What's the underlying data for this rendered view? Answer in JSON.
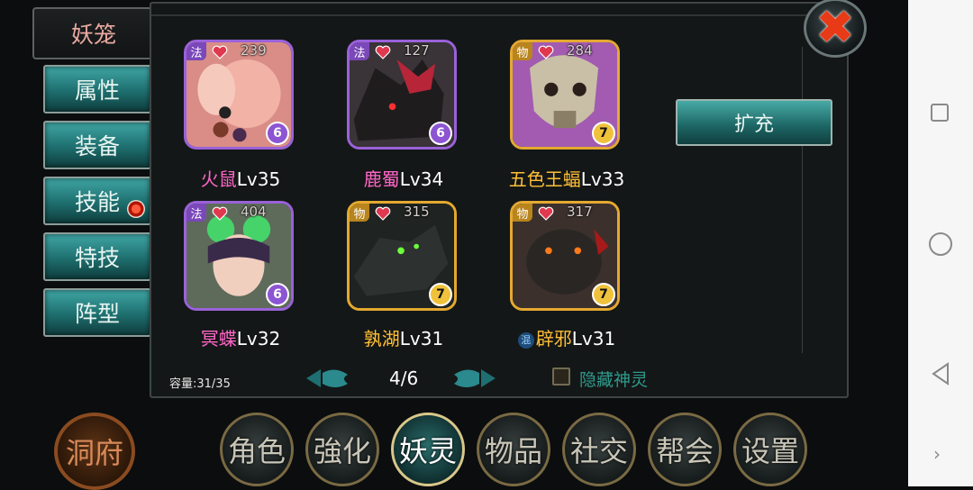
{
  "sidebar": {
    "header_tab": "妖笼",
    "tabs": [
      "属性",
      "装备",
      "技能",
      "特技",
      "阵型"
    ],
    "notification_on": "技能"
  },
  "panel": {
    "expand_label": "扩充",
    "capacity": "容量:31/35",
    "page": "4/6",
    "hide_label": "隐藏神灵"
  },
  "monsters": [
    {
      "name": "火鼠",
      "level": "Lv35",
      "type": "法",
      "hp": "239",
      "star": "6",
      "rarity": "purple"
    },
    {
      "name": "鹿蜀",
      "level": "Lv34",
      "type": "法",
      "hp": "127",
      "star": "6",
      "rarity": "purple"
    },
    {
      "name": "五色王蝠",
      "level": "Lv33",
      "type": "物",
      "hp": "284",
      "star": "7",
      "rarity": "gold"
    },
    {
      "name": "冥蝶",
      "level": "Lv32",
      "type": "法",
      "hp": "404",
      "star": "6",
      "rarity": "purple"
    },
    {
      "name": "孰湖",
      "level": "Lv31",
      "type": "物",
      "hp": "315",
      "star": "7",
      "rarity": "gold"
    },
    {
      "name": "辟邪",
      "level": "Lv31",
      "type": "物",
      "hp": "317",
      "star": "7",
      "rarity": "gold",
      "prefix": "混"
    }
  ],
  "bottom_nav": {
    "cave": "洞府",
    "items": [
      "角色",
      "強化",
      "妖灵",
      "物品",
      "社交",
      "帮会",
      "设置"
    ],
    "active": "妖灵"
  },
  "colors": {
    "accent_teal": "#2f9a8c",
    "close_red": "#e83a16",
    "purple_rarity": "#9a62d9",
    "gold_rarity": "#e4a930"
  }
}
